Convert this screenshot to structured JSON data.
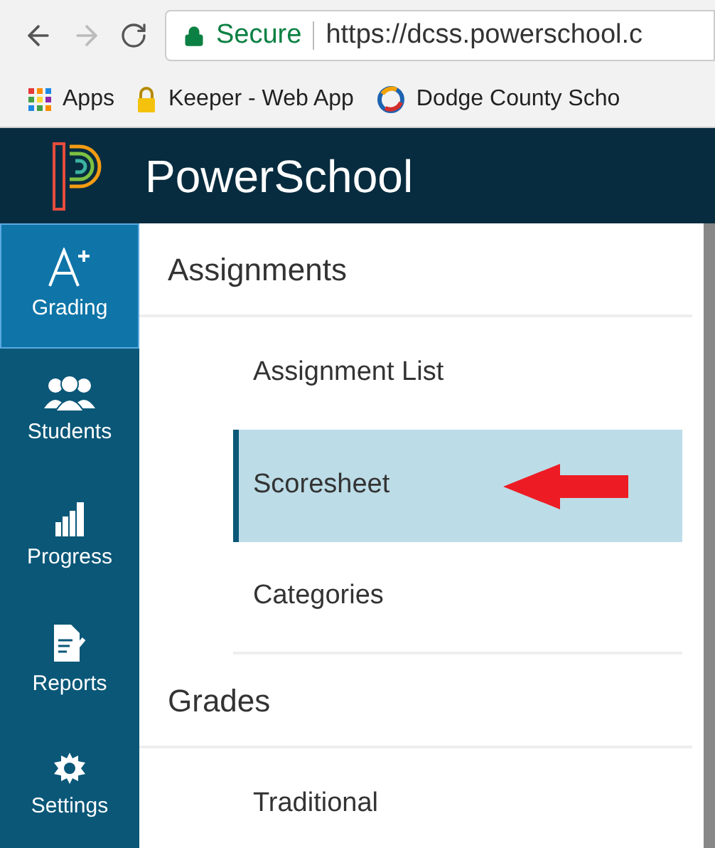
{
  "browser": {
    "secure_label": "Secure",
    "url": "https://dcss.powerschool.c",
    "bookmarks": [
      {
        "kind": "apps",
        "label": "Apps"
      },
      {
        "kind": "lock",
        "label": "Keeper - Web App"
      },
      {
        "kind": "logo",
        "label": "Dodge County Scho"
      }
    ]
  },
  "header": {
    "title": "PowerSchool"
  },
  "sidebar": {
    "items": [
      {
        "kind": "grading",
        "label": "Grading",
        "selected": true
      },
      {
        "kind": "students",
        "label": "Students",
        "selected": false
      },
      {
        "kind": "progress",
        "label": "Progress",
        "selected": false
      },
      {
        "kind": "reports",
        "label": "Reports",
        "selected": false
      },
      {
        "kind": "settings",
        "label": "Settings",
        "selected": false
      }
    ]
  },
  "menu": {
    "sections": [
      {
        "title": "Assignments",
        "items": [
          {
            "label": "Assignment List",
            "selected": false
          },
          {
            "label": "Scoresheet",
            "selected": true
          },
          {
            "label": "Categories",
            "selected": false
          }
        ]
      },
      {
        "title": "Grades",
        "items": [
          {
            "label": "Traditional",
            "selected": false
          }
        ]
      }
    ]
  }
}
